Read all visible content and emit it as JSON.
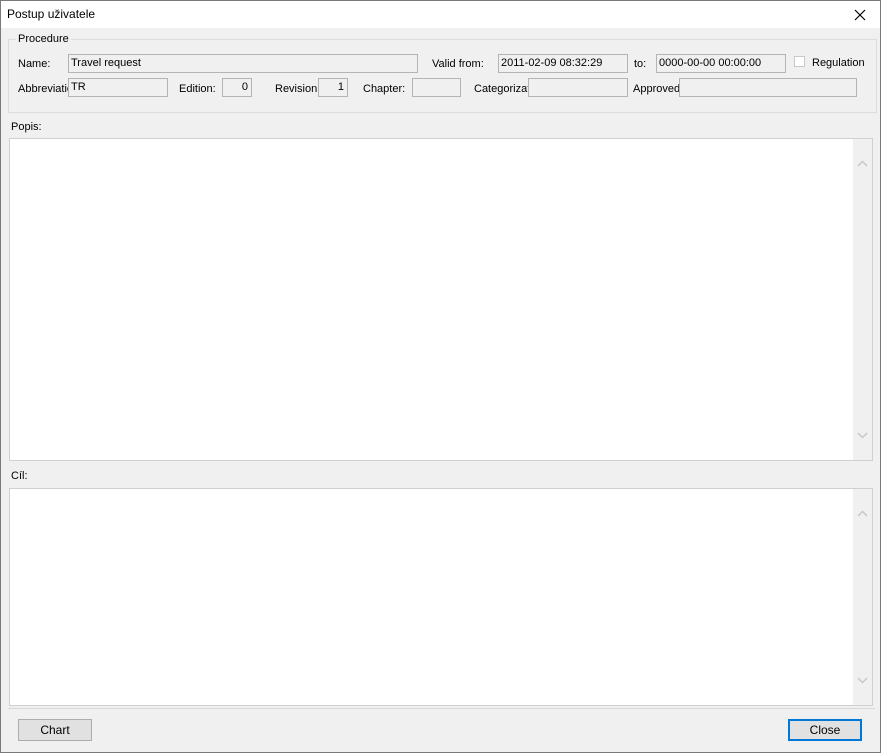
{
  "window": {
    "title": "Postup uživatele"
  },
  "procedure": {
    "legend": "Procedure",
    "name_label": "Name:",
    "name_value": "Travel request",
    "valid_from_label": "Valid from:",
    "valid_from_value": "2011-02-09 08:32:29",
    "to_label": "to:",
    "to_value": "0000-00-00 00:00:00",
    "regulation_label": "Regulation",
    "regulation_checked": false,
    "abbreviation_label": "Abbreviation",
    "abbreviation_value": "TR",
    "edition_label": "Edition:",
    "edition_value": "0",
    "revision_label": "Revision",
    "revision_value": "1",
    "chapter_label": "Chapter:",
    "chapter_value": "",
    "categorization_label": "Categorization",
    "categorization_value": "",
    "approved_label": "Approved",
    "approved_value": ""
  },
  "popis": {
    "label": "Popis:",
    "text": ""
  },
  "cil": {
    "label": "Cíl:",
    "text": ""
  },
  "buttons": {
    "chart": "Chart",
    "close": "Close"
  },
  "icons": {
    "close": "close-icon",
    "scroll_up": "chevron-up-icon",
    "scroll_down": "chevron-down-icon"
  }
}
